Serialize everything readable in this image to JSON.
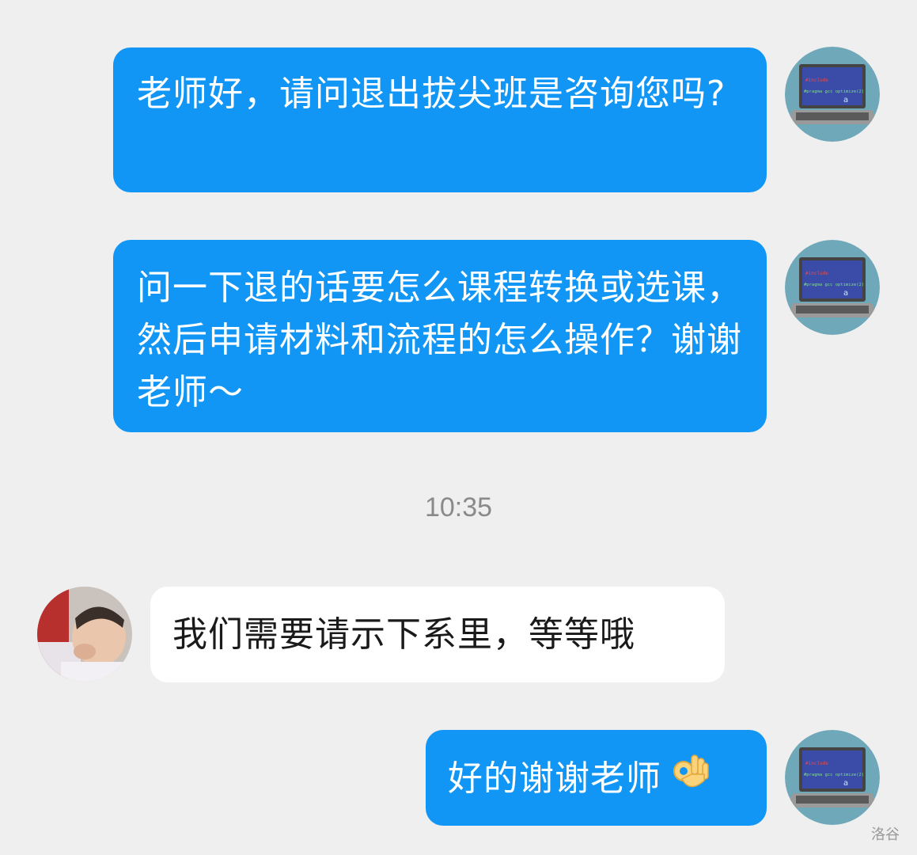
{
  "conversation": {
    "messages": [
      {
        "sender": "self",
        "text": "老师好，请问退出拔尖班是咨询您吗?"
      },
      {
        "sender": "self",
        "text": "问一下退的话要怎么课程转换或选课，然后申请材料和流程的怎么操作？谢谢老师～"
      },
      {
        "sender": "other",
        "text": "我们需要请示下系里，等等哦"
      },
      {
        "sender": "self",
        "text": "好的谢谢老师",
        "emoji": "ok-hand-emoji"
      }
    ],
    "timestamp": "10:35"
  },
  "avatars": {
    "self": {
      "icon": "laptop-avatar-icon",
      "screen_text": "#pragma gcc optimize(2)",
      "key": "a"
    },
    "other": {
      "icon": "baby-photo-avatar-icon"
    }
  },
  "watermark": "洛谷",
  "colors": {
    "outgoing_bubble": "#1296f5",
    "incoming_bubble": "#ffffff",
    "background": "#efeff0"
  }
}
